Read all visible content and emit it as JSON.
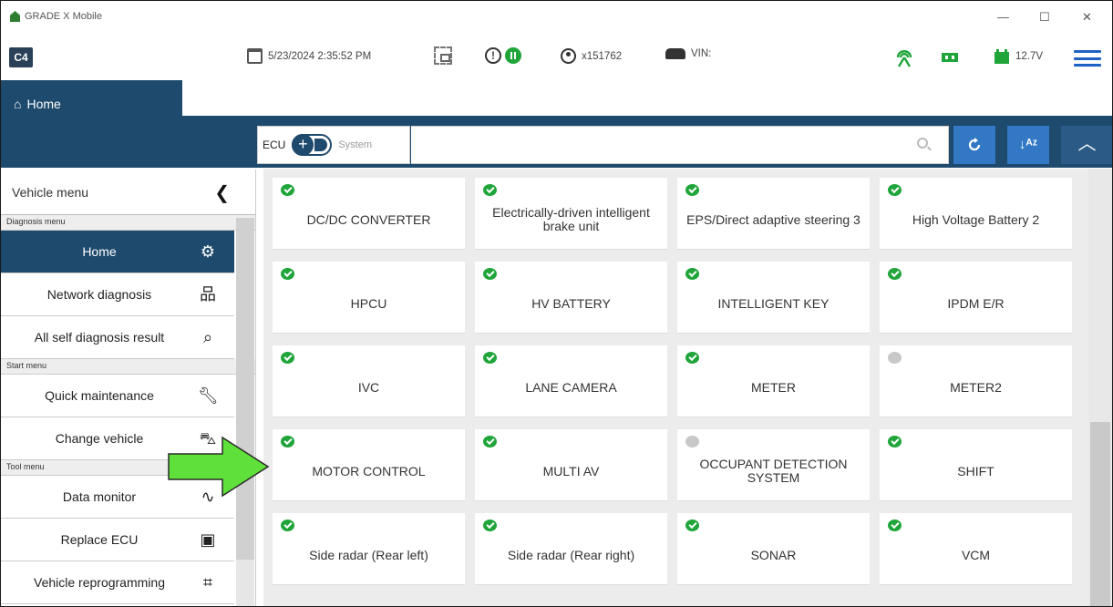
{
  "window": {
    "title": "GRADE X Mobile",
    "controls": [
      "—",
      "☐",
      "✕"
    ]
  },
  "toolbar": {
    "logo": "C4",
    "datetime": "5/23/2024 2:35:52 PM",
    "user": "x151762",
    "vin_label": "VIN:",
    "voltage": "12.7V"
  },
  "tabs": {
    "home": "Home"
  },
  "filter": {
    "ecu_label": "ECU",
    "toggle_symbol": "+",
    "system_label": "System",
    "search_value": ""
  },
  "sidebar": {
    "title": "Vehicle menu",
    "sections": [
      {
        "label": "Diagnosis menu",
        "items": [
          {
            "label": "Home",
            "icon": "gear-icon",
            "active": true
          },
          {
            "label": "Network diagnosis",
            "icon": "network-icon"
          },
          {
            "label": "All self diagnosis result",
            "icon": "search-car-icon"
          }
        ]
      },
      {
        "label": "Start menu",
        "items": [
          {
            "label": "Quick maintenance",
            "icon": "wrench-icon"
          },
          {
            "label": "Change vehicle",
            "icon": "car-icon"
          }
        ]
      },
      {
        "label": "Tool menu",
        "items": [
          {
            "label": "Data monitor",
            "icon": "waveform-icon"
          },
          {
            "label": "Replace ECU",
            "icon": "chip-icon"
          },
          {
            "label": "Vehicle reprogramming",
            "icon": "reprogram-icon"
          }
        ]
      }
    ]
  },
  "ecus": [
    {
      "label": "DC/DC CONVERTER",
      "ok": true
    },
    {
      "label": "Electrically-driven intelligent brake unit",
      "ok": true
    },
    {
      "label": "EPS/Direct adaptive steering 3",
      "ok": true
    },
    {
      "label": "High Voltage Battery 2",
      "ok": true
    },
    {
      "label": "HPCU",
      "ok": true
    },
    {
      "label": "HV BATTERY",
      "ok": true
    },
    {
      "label": "INTELLIGENT KEY",
      "ok": true
    },
    {
      "label": "IPDM E/R",
      "ok": true
    },
    {
      "label": "IVC",
      "ok": true
    },
    {
      "label": "LANE CAMERA",
      "ok": true
    },
    {
      "label": "METER",
      "ok": true
    },
    {
      "label": "METER2",
      "ok": false
    },
    {
      "label": "MOTOR CONTROL",
      "ok": true
    },
    {
      "label": "MULTI AV",
      "ok": true
    },
    {
      "label": "OCCUPANT DETECTION SYSTEM",
      "ok": false
    },
    {
      "label": "SHIFT",
      "ok": true
    },
    {
      "label": "Side radar (Rear left)",
      "ok": true
    },
    {
      "label": "Side radar (Rear right)",
      "ok": true
    },
    {
      "label": "SONAR",
      "ok": true
    },
    {
      "label": "VCM",
      "ok": true
    }
  ],
  "colors": {
    "header_blue": "#1e4a6d",
    "button_blue": "#3278c4",
    "status_green": "#1fa53a",
    "arrow_green": "#5fe03a"
  }
}
